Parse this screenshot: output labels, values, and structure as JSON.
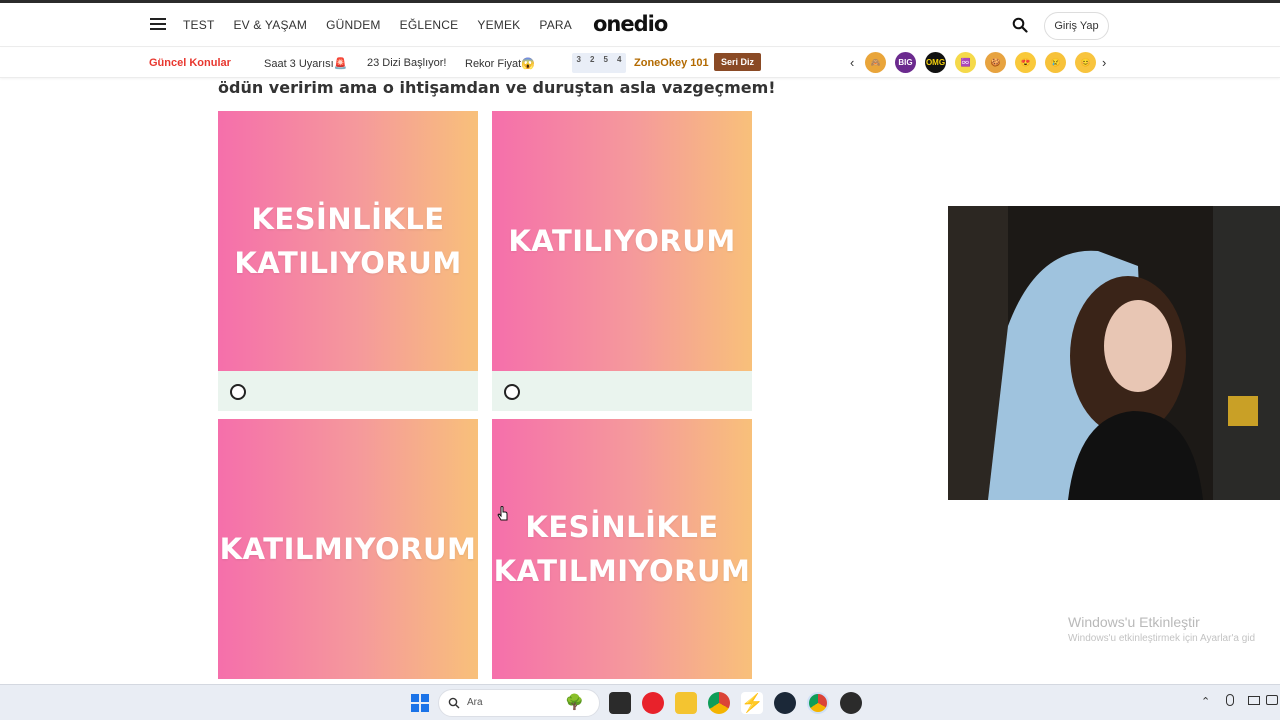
{
  "header": {
    "nav": [
      "TEST",
      "EV & YAŞAM",
      "GÜNDEM",
      "EĞLENCE",
      "YEMEK",
      "PARA"
    ],
    "logo": "onedio",
    "login_label": "Giriş Yap"
  },
  "subbar": {
    "title": "Güncel Konular",
    "topics": [
      "Saat 3 Uyarısı🚨",
      "23 Dizi Başlıyor!",
      "Rekor Fiyat😱"
    ],
    "zone_numbers": [
      "3",
      "2",
      "5",
      "4"
    ],
    "zone_title": "ZoneOkey 101",
    "seri_diz": "Seri Diz",
    "prev_arrow": "‹",
    "next_arrow": "›",
    "emojis": [
      "🙈",
      "BIG POP",
      "OMG",
      "♾️",
      "🍪",
      "😍",
      "😢",
      "😊"
    ]
  },
  "main": {
    "question": "ödün veririm ama o ihtişamdan ve duruştan asla vazgeçmem!",
    "options": [
      {
        "label": "KESİNLİKLE\nKATILIYORUM"
      },
      {
        "label": "KATILIYORUM"
      },
      {
        "label": "KATILMIYORUM"
      },
      {
        "label": "KESİNLİKLE\nKATILMIYORUM"
      }
    ]
  },
  "watermark": {
    "line1": "Windows'u Etkinleştir",
    "line2": "Windows'u etkinleştirmek için Ayarlar'a gid"
  },
  "taskbar": {
    "search_placeholder": "Ara"
  },
  "colors": {
    "accent_red": "#e8372f",
    "card_gradient": [
      "#f56fab",
      "#f8c07a"
    ],
    "radio_bg": "#eaf4ee"
  }
}
